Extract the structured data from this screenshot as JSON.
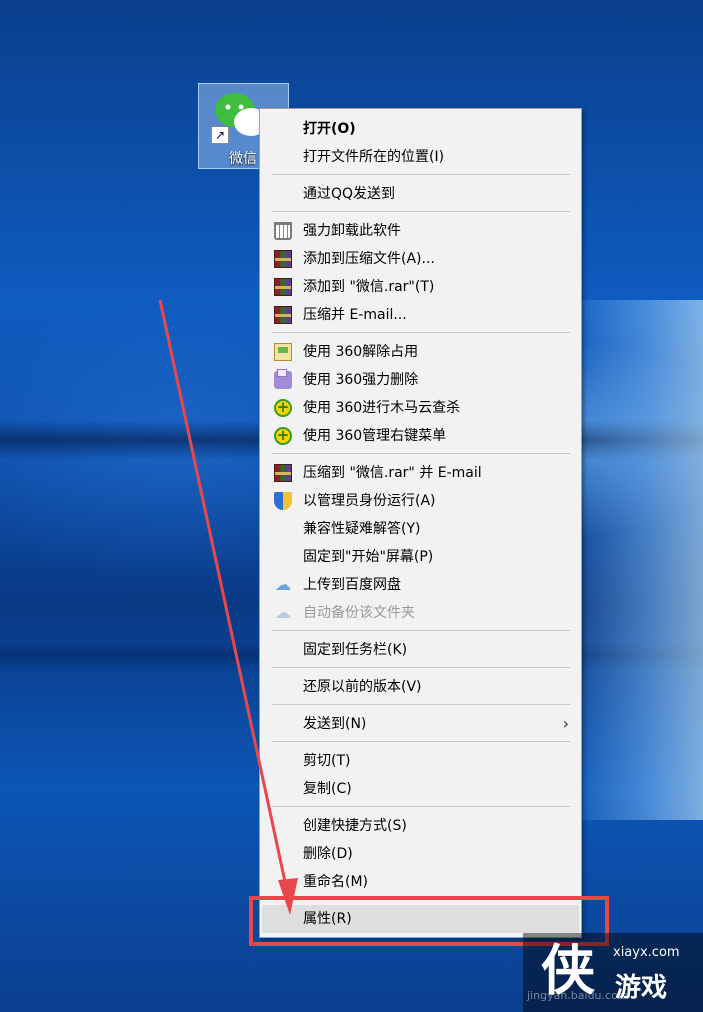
{
  "desktop": {
    "icon_label": "微信"
  },
  "menu": {
    "items": [
      {
        "label": "打开(O)",
        "icon": ""
      },
      {
        "label": "打开文件所在的位置(I)",
        "icon": ""
      },
      {
        "label": "通过QQ发送到",
        "icon": ""
      },
      {
        "label": "强力卸载此软件",
        "icon": "trash-icon"
      },
      {
        "label": "添加到压缩文件(A)...",
        "icon": "winrar-icon"
      },
      {
        "label": "添加到 \"微信.rar\"(T)",
        "icon": "winrar-icon"
      },
      {
        "label": "压缩并 E-mail...",
        "icon": "winrar-icon"
      },
      {
        "label": "使用 360解除占用",
        "icon": "unlock-360-icon"
      },
      {
        "label": "使用 360强力删除",
        "icon": "shredder-360-icon"
      },
      {
        "label": "使用 360进行木马云查杀",
        "icon": "plus-360-icon"
      },
      {
        "label": "使用 360管理右键菜单",
        "icon": "plus-360-icon"
      },
      {
        "label": "压缩到 \"微信.rar\" 并 E-mail",
        "icon": "winrar-icon"
      },
      {
        "label": "以管理员身份运行(A)",
        "icon": "uac-shield-icon"
      },
      {
        "label": "兼容性疑难解答(Y)",
        "icon": ""
      },
      {
        "label": "固定到\"开始\"屏幕(P)",
        "icon": ""
      },
      {
        "label": "上传到百度网盘",
        "icon": "baidu-cloud-icon"
      },
      {
        "label": "自动备份该文件夹",
        "icon": "baidu-cloud-icon"
      },
      {
        "label": "固定到任务栏(K)",
        "icon": ""
      },
      {
        "label": "还原以前的版本(V)",
        "icon": ""
      },
      {
        "label": "发送到(N)",
        "icon": ""
      },
      {
        "label": "剪切(T)",
        "icon": ""
      },
      {
        "label": "复制(C)",
        "icon": ""
      },
      {
        "label": "创建快捷方式(S)",
        "icon": ""
      },
      {
        "label": "删除(D)",
        "icon": ""
      },
      {
        "label": "重命名(M)",
        "icon": ""
      },
      {
        "label": "属性(R)",
        "icon": ""
      }
    ],
    "submenu_arrow": "›"
  },
  "watermark": {
    "logo_char": "侠",
    "site": "xiayx.com",
    "brand": "游戏",
    "faint": "jingyan.baidu.com"
  },
  "colors": {
    "annotation": "#e8474b",
    "menu_bg": "#f2f2f2",
    "highlight": "#dedede"
  }
}
